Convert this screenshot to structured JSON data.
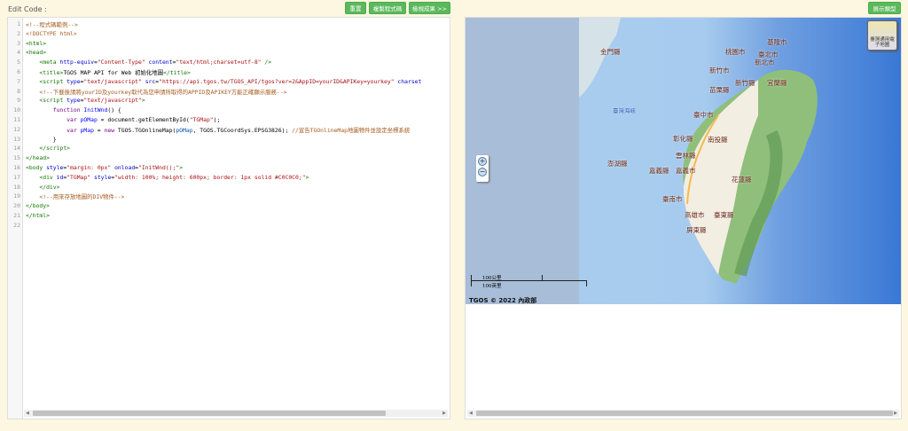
{
  "header": {
    "edit_label": "Edit Code :",
    "reset": "重置",
    "copy": "複製程式碼",
    "view": "檢視成果 >>",
    "show_type": "展示類型"
  },
  "code": [
    [
      [
        "comment",
        "<!--程式碼範例-->"
      ]
    ],
    [
      [
        "comment",
        "<!DOCTYPE html>"
      ]
    ],
    [
      [
        "tag",
        "<html>"
      ]
    ],
    [
      [
        "tag",
        "<head>"
      ]
    ],
    [
      [
        "",
        "    "
      ],
      [
        "tag",
        "<meta "
      ],
      [
        "attr",
        "http-equiv"
      ],
      [
        "",
        "="
      ],
      [
        "str",
        "\"Content-Type\""
      ],
      [
        "attr",
        " content"
      ],
      [
        "",
        "="
      ],
      [
        "str",
        "\"text/html;charset=utf-8\""
      ],
      [
        "tag",
        " />"
      ]
    ],
    [
      [
        "",
        "    "
      ],
      [
        "tag",
        "<title>"
      ],
      [
        "",
        "TGOS MAP API for Web 初始化地圖"
      ],
      [
        "tag",
        "</title>"
      ]
    ],
    [
      [
        "",
        "    "
      ],
      [
        "tag",
        "<script "
      ],
      [
        "attr",
        "type"
      ],
      [
        "",
        "="
      ],
      [
        "str",
        "\"text/javascript\""
      ],
      [
        "attr",
        " src"
      ],
      [
        "",
        "="
      ],
      [
        "str",
        "\"https://api.tgos.tw/TGOS_API/tgos?ver=2&AppID=yourID&APIKey=yourkey\""
      ],
      [
        "attr",
        " charset"
      ]
    ],
    [
      [
        "",
        "    "
      ],
      [
        "comment",
        "<!--下載後請將yourID及yourkey取代為您申請所取得的APPID及APIKEY方能正確顯示服務-->"
      ]
    ],
    [
      [
        "",
        "    "
      ],
      [
        "tag",
        "<script "
      ],
      [
        "attr",
        "type"
      ],
      [
        "",
        "="
      ],
      [
        "str",
        "\"text/javascript\""
      ],
      [
        "tag",
        ">"
      ]
    ],
    [
      [
        "",
        "        "
      ],
      [
        "kw",
        "function "
      ],
      [
        "def",
        "InitWnd"
      ],
      [
        "",
        "() {"
      ]
    ],
    [
      [
        "",
        "            "
      ],
      [
        "kw",
        "var "
      ],
      [
        "def",
        "pOMap"
      ],
      [
        "",
        " = document.getElementById("
      ],
      [
        "str",
        "\"TGMap\""
      ],
      [
        "",
        ");"
      ]
    ],
    [
      [
        "",
        "            "
      ],
      [
        "kw",
        "var "
      ],
      [
        "def",
        "pMap"
      ],
      [
        "",
        " = "
      ],
      [
        "kw",
        "new "
      ],
      [
        "",
        "TGOS.TGOnlineMap("
      ],
      [
        "var",
        "pOMap"
      ],
      [
        "",
        ", TGOS.TGCoordSys.EPSG3826); "
      ],
      [
        "comment",
        "//宣告TGOnlineMap地圖物件並設定坐標系統"
      ]
    ],
    [
      [
        "",
        "        }"
      ]
    ],
    [
      [
        "",
        "    "
      ],
      [
        "tag",
        "</script>"
      ]
    ],
    [
      [
        "tag",
        "</head>"
      ]
    ],
    [
      [
        "tag",
        "<body "
      ],
      [
        "attr",
        "style"
      ],
      [
        "",
        "="
      ],
      [
        "str",
        "\"margin: 0px\""
      ],
      [
        "attr",
        " onload"
      ],
      [
        "",
        "="
      ],
      [
        "str",
        "\"InitWnd();\""
      ],
      [
        "tag",
        ">"
      ]
    ],
    [
      [
        "",
        "    "
      ],
      [
        "tag",
        "<div "
      ],
      [
        "attr",
        "id"
      ],
      [
        "",
        "="
      ],
      [
        "str",
        "\"TGMap\""
      ],
      [
        "attr",
        " style"
      ],
      [
        "",
        "="
      ],
      [
        "str",
        "\"width: 100%; height: 600px; border: 1px solid #C0C0C0;\""
      ],
      [
        "tag",
        ">"
      ]
    ],
    [
      [
        "",
        "    "
      ],
      [
        "tag",
        "</div>"
      ]
    ],
    [
      [
        "",
        "    "
      ],
      [
        "comment",
        "<!--用來存放地圖的DIV物件-->"
      ]
    ],
    [
      [
        "tag",
        "</body>"
      ]
    ],
    [
      [
        "tag",
        "</html>"
      ]
    ],
    [
      [
        "",
        ""
      ]
    ]
  ],
  "map": {
    "layer_button": "臺灣通用電子地圖",
    "labels": [
      "金門縣",
      "基隆市",
      "桃園市",
      "臺北市",
      "新北市",
      "新竹市",
      "新竹縣",
      "宜蘭縣",
      "苗栗縣",
      "臺灣海峽",
      "臺中市",
      "澎湖縣",
      "彰化縣",
      "南投縣",
      "雲林縣",
      "嘉義縣",
      "嘉義市",
      "花蓮縣",
      "臺南市",
      "高雄市",
      "臺東縣",
      "屏東縣"
    ],
    "scale_km": "100公里",
    "scale_mi": "100英里",
    "copyright": "TGOS © 2022 內政部",
    "zoom_in": "+",
    "zoom_out": "−"
  }
}
